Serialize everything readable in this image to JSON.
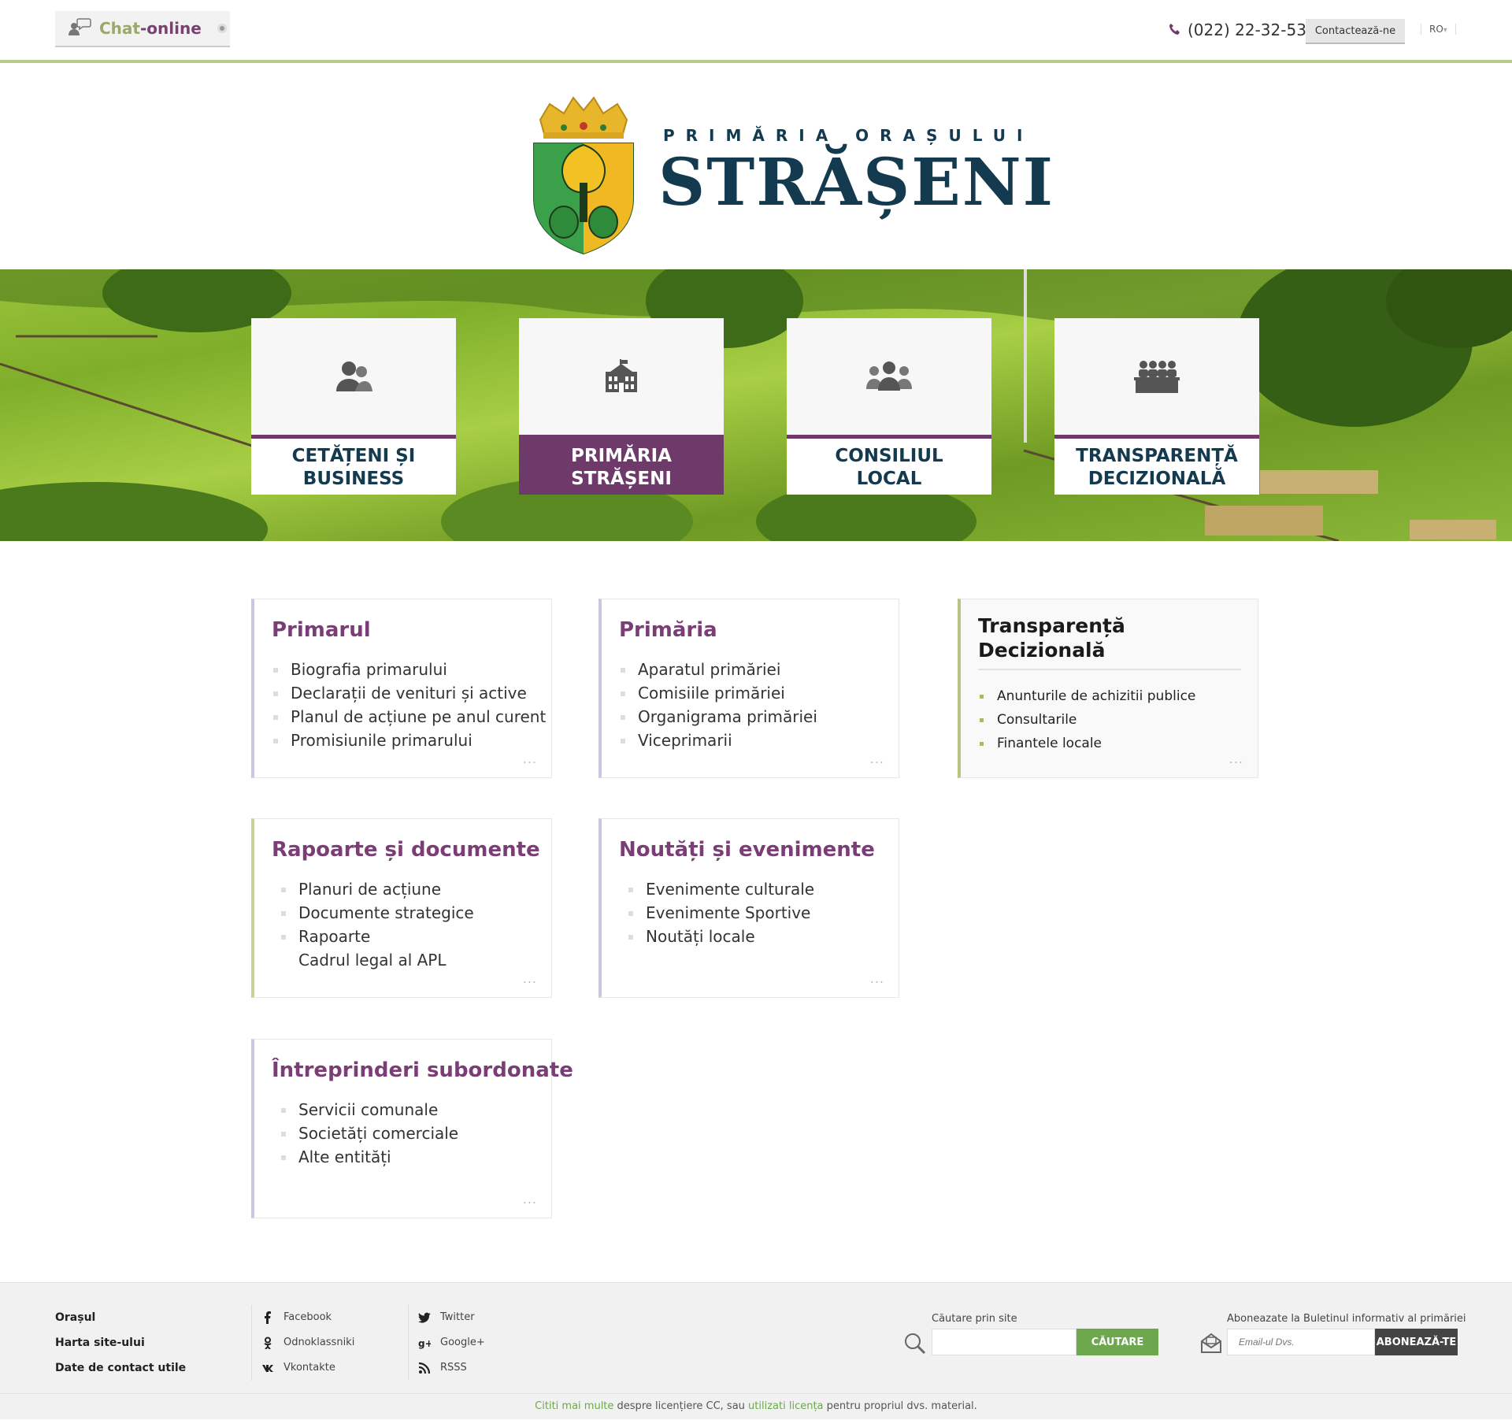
{
  "topbar": {
    "chat_a": "Chat",
    "chat_b": "-online",
    "phone": "(022) 22-32-53",
    "contact_label": "Contactează-ne",
    "lang": "RO"
  },
  "logo": {
    "subtitle": "PRIMĂRIA ORAȘULUI",
    "title": "STRĂȘENI"
  },
  "hero_cards": [
    {
      "l1": "CETĂȚENI ȘI",
      "l2": "BUSINESS",
      "icon": "citizens-icon"
    },
    {
      "l1": "PRIMĂRIA",
      "l2": "STRĂȘENI",
      "icon": "cityhall-icon"
    },
    {
      "l1": "CONSILIUL",
      "l2": "LOCAL",
      "icon": "council-icon"
    },
    {
      "l1": "TRANSPARENȚĂ",
      "l2": "DECIZIONALĂ",
      "icon": "transparency-icon"
    }
  ],
  "cards": {
    "primarul": {
      "title": "Primarul",
      "items": [
        "Biografia primarului",
        "Declarații de venituri și active",
        "Planul de acțiune pe anul curent",
        "Promisiunile primarului"
      ]
    },
    "primaria": {
      "title": "Primăria",
      "items": [
        "Aparatul primăriei",
        "Comisiile primăriei",
        "Organigrama primăriei",
        "Viceprimarii"
      ]
    },
    "transparenta": {
      "title": "Transparență Decizională",
      "items": [
        "Anunturile de achizitii publice",
        "Consultarile",
        "Finantele locale"
      ]
    },
    "rapoarte": {
      "title": "Rapoarte și documente",
      "items": [
        "Planuri de acțiune",
        "Documente strategice",
        "Rapoarte",
        "Cadrul legal al APL"
      ]
    },
    "noutati": {
      "title": "Noutăți și evenimente",
      "items": [
        "Evenimente culturale",
        "Evenimente Sportive",
        "Noutăți locale"
      ]
    },
    "intreprinderi": {
      "title": "Întreprinderi subordonate",
      "items": [
        "Servicii comunale",
        "Societăți comerciale",
        "Alte entități"
      ]
    },
    "more": "..."
  },
  "footer": {
    "links": [
      "Orașul",
      "Harta site-ului",
      "Date de contact utile"
    ],
    "social1": [
      "Facebook",
      "Odnoklassniki",
      "Vkontakte"
    ],
    "social2": [
      "Twitter",
      "Google+",
      "RSSS"
    ],
    "search_label": "Căutare prin site",
    "search_btn": "CĂUTARE",
    "sub_label": "Aboneazate la Buletinul informativ al primăriei",
    "sub_placeholder": "Email-ul Dvs.",
    "sub_btn": "ABONEAZĂ-TE",
    "copy_a": "Cititi mai multe",
    "copy_b": " despre licențiere CC, sau ",
    "copy_c": "utilizati licența",
    "copy_d": " pentru propriul dvs. material."
  },
  "colors": {
    "accent": "#6d3a6a",
    "green_line": "#b9c98c",
    "navy": "#133a4e",
    "button_green": "#6da84f"
  }
}
